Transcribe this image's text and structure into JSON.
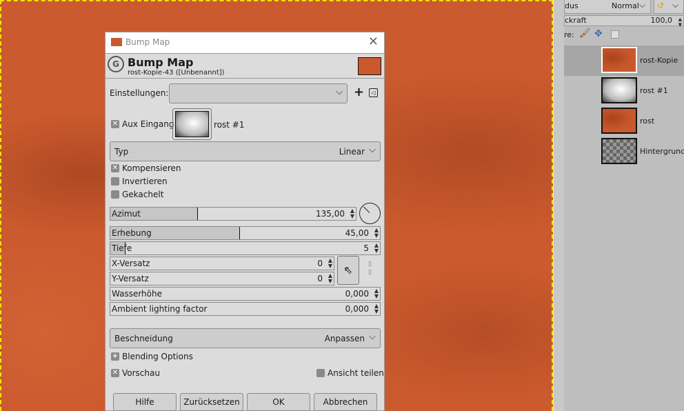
{
  "panel": {
    "mode_label_partial": "dus",
    "mode_value": "Normal",
    "opacity_label_partial": "ckraft",
    "opacity_value": "100,0",
    "lock_label_partial": "re:",
    "layers": [
      {
        "name": "rost-Kopie",
        "selected": true
      },
      {
        "name": "rost #1"
      },
      {
        "name": "rost"
      },
      {
        "name": "Hintergrund"
      }
    ]
  },
  "dialog": {
    "window_title": "Bump Map",
    "header_title": "Bump Map",
    "header_subtitle": "rost-Kopie-43 ([Unbenannt])",
    "settings_label": "Einstellungen:",
    "settings_value": "",
    "aux_label": "Aux Eingang",
    "aux_layer": "rost #1",
    "aux_checked": true,
    "typ_label": "Typ",
    "typ_value": "Linear",
    "kompensieren": "Kompensieren",
    "invertieren": "Invertieren",
    "gekachelt": "Gekachelt",
    "azimut_label": "Azimut",
    "azimut_value": "135,00",
    "azimut_fraction": 0.375,
    "erhebung_label": "Erhebung",
    "erhebung_value": "45,00",
    "erhebung_fraction": 0.5,
    "tiefe_label": "Tiefe",
    "tiefe_value": "5",
    "tiefe_fraction": 0.06,
    "xoffset_label": "X-Versatz",
    "xoffset_value": "0",
    "yoffset_label": "Y-Versatz",
    "yoffset_value": "0",
    "waterlevel_label": "Wasserhöhe",
    "waterlevel_value": "0,000",
    "ambient_label": "Ambient lighting factor",
    "ambient_value": "0,000",
    "clip_label": "Beschneidung",
    "clip_value": "Anpassen",
    "blending_label": "Blending Options",
    "preview_label": "Vorschau",
    "split_label": "Ansicht teilen",
    "buttons": {
      "help": "Hilfe",
      "reset": "Zurücksetzen",
      "ok": "OK",
      "cancel": "Abbrechen"
    }
  },
  "colors": {
    "canvas": "#cb5a2e",
    "selection": "#f2e600"
  }
}
